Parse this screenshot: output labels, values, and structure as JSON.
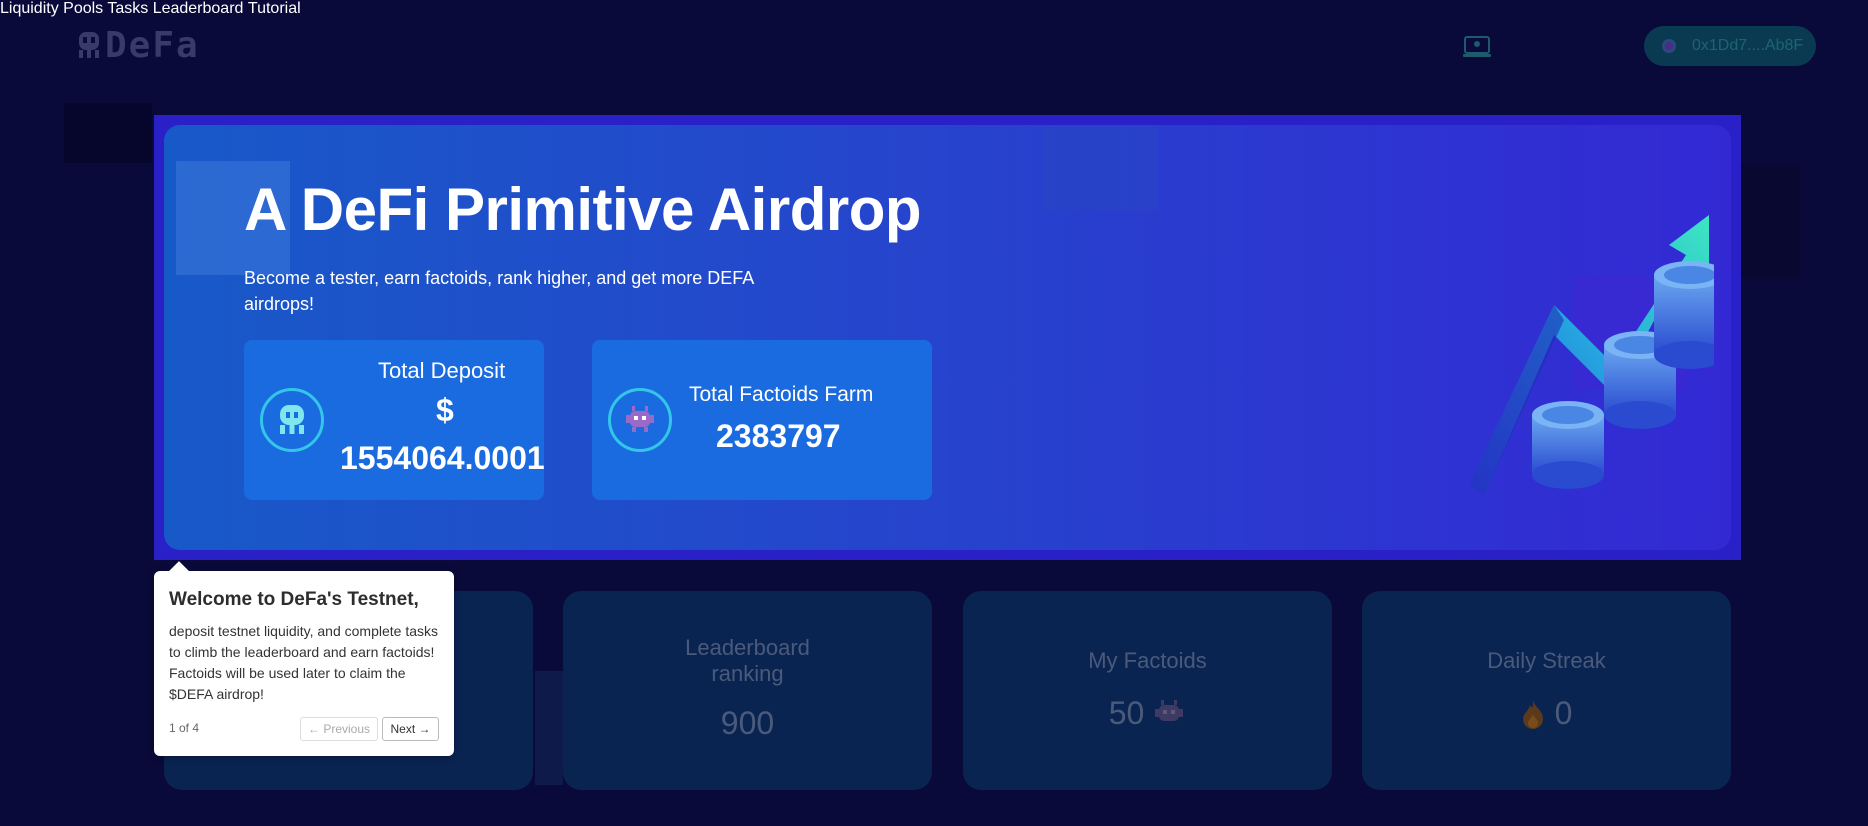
{
  "header": {
    "logo_text": "DeFa",
    "nav": [
      {
        "label": "Liquidity Pools"
      },
      {
        "label": "Tasks"
      },
      {
        "label": "Leaderboard"
      },
      {
        "label": "Tutorial"
      }
    ],
    "wallet_label": "0x1Dd7....Ab8F"
  },
  "hero": {
    "title": "A DeFi Primitive Airdrop",
    "subtitle": "Become a tester, earn factoids, rank higher, and get more DEFA airdrops!",
    "deposit": {
      "label": "Total Deposit",
      "currency": "$",
      "value": "1554064.0001"
    },
    "factoids_farm": {
      "label": "Total Factoids Farm",
      "value": "2383797"
    }
  },
  "stats": {
    "leaderboard": {
      "label_line1": "Leaderboard",
      "label_line2": "ranking",
      "value": "900"
    },
    "my_factoids": {
      "label": "My Factoids",
      "value": "50"
    },
    "daily_streak": {
      "label": "Daily Streak",
      "value": "0"
    }
  },
  "tour": {
    "title": "Welcome to DeFa's Testnet,",
    "body": "deposit testnet liquidity, and complete tasks to climb the leaderboard and earn factoids! Factoids will be used later to claim the $DEFA airdrop!",
    "progress": "1 of 4",
    "prev_label": "← Previous",
    "next_label": "Next →"
  },
  "colors": {
    "background": "#0a0a3a",
    "hero_start": "#1859c8",
    "hero_end": "#3329d4",
    "card": "#1a6be0",
    "accent_cyan": "#33c6e8"
  },
  "icons": [
    "logo-icon",
    "tutorial-icon",
    "wallet-avatar-icon",
    "ghost-icon",
    "alien-icon",
    "flame-icon",
    "coins-arrow-illustration"
  ]
}
